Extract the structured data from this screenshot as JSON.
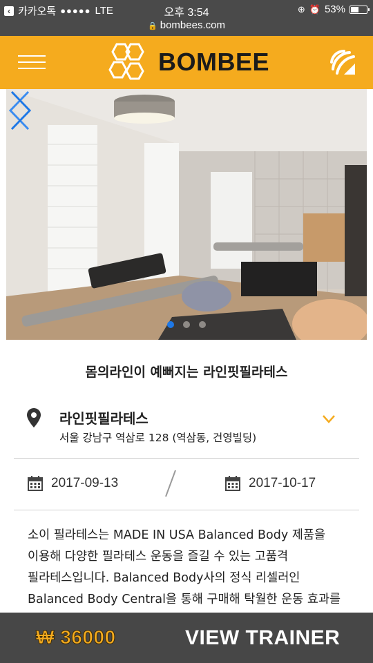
{
  "status_bar": {
    "back_app": "카카오톡",
    "signal": "●●●●●",
    "network": "LTE",
    "time": "오후 3:54",
    "battery_text": "53%",
    "battery_level": 0.53
  },
  "url_bar": {
    "url": "bombees.com"
  },
  "header": {
    "logo_text": "BOMBEE",
    "brand_color": "#f5ab1e",
    "menu_icon": "hamburger-icon",
    "right_icon": "bombee-feed-icon"
  },
  "hero": {
    "image_description": "Pilates studio with reformer machines",
    "slide_count": 3,
    "active_slide": 1,
    "prev_icon": "chevron-left-icon",
    "next_icon": "chevron-right-icon",
    "accent_color": "#1e78e6"
  },
  "listing": {
    "title": "몸의라인이 예뻐지는 라인핏필라테스",
    "place_name": "라인핏필라테스",
    "address": "서울 강남구 역삼로 128 (역삼동, 건영빌딩)",
    "start_date": "2017-09-13",
    "end_date": "2017-10-17",
    "description": "소이 필라테스는 MADE IN USA Balanced Body 제품을 이용해 다양한 필라테스 운동을 즐길 수 있는 고품격 필라테스입니다. Balanced Body사의 정식 리셀러인 Balanced Body Central을 통해 구매해 탁월한 운동 효과를 경험하실 수 있습니다. 그럼 운동 및 유연성 향상을"
  },
  "bottom_bar": {
    "price": "₩ 36000",
    "cta_label": "VIEW TRAINER"
  }
}
